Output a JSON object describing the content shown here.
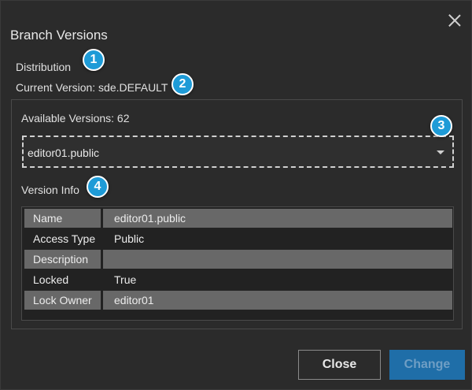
{
  "dialog": {
    "title": "Branch Versions",
    "distribution_label": "Distribution",
    "current_version": "Current Version: sde.DEFAULT",
    "available_versions": "Available Versions: 62",
    "selected_version": "editor01.public",
    "version_info_label": "Version Info"
  },
  "version_info": [
    {
      "key": "Name",
      "value": "editor01.public"
    },
    {
      "key": "Access Type",
      "value": "Public"
    },
    {
      "key": "Description",
      "value": ""
    },
    {
      "key": "Locked",
      "value": "True"
    },
    {
      "key": "Lock Owner",
      "value": "editor01"
    }
  ],
  "badges": [
    "1",
    "2",
    "3",
    "4"
  ],
  "buttons": {
    "close_label": "Close",
    "change_label": "Change"
  },
  "icons": {
    "close": "close-icon",
    "dropdown": "chevron-down-icon"
  },
  "colors": {
    "accent": "#1e9bd7",
    "primary_button": "#1f6ea8",
    "background": "#2b2b2b"
  }
}
